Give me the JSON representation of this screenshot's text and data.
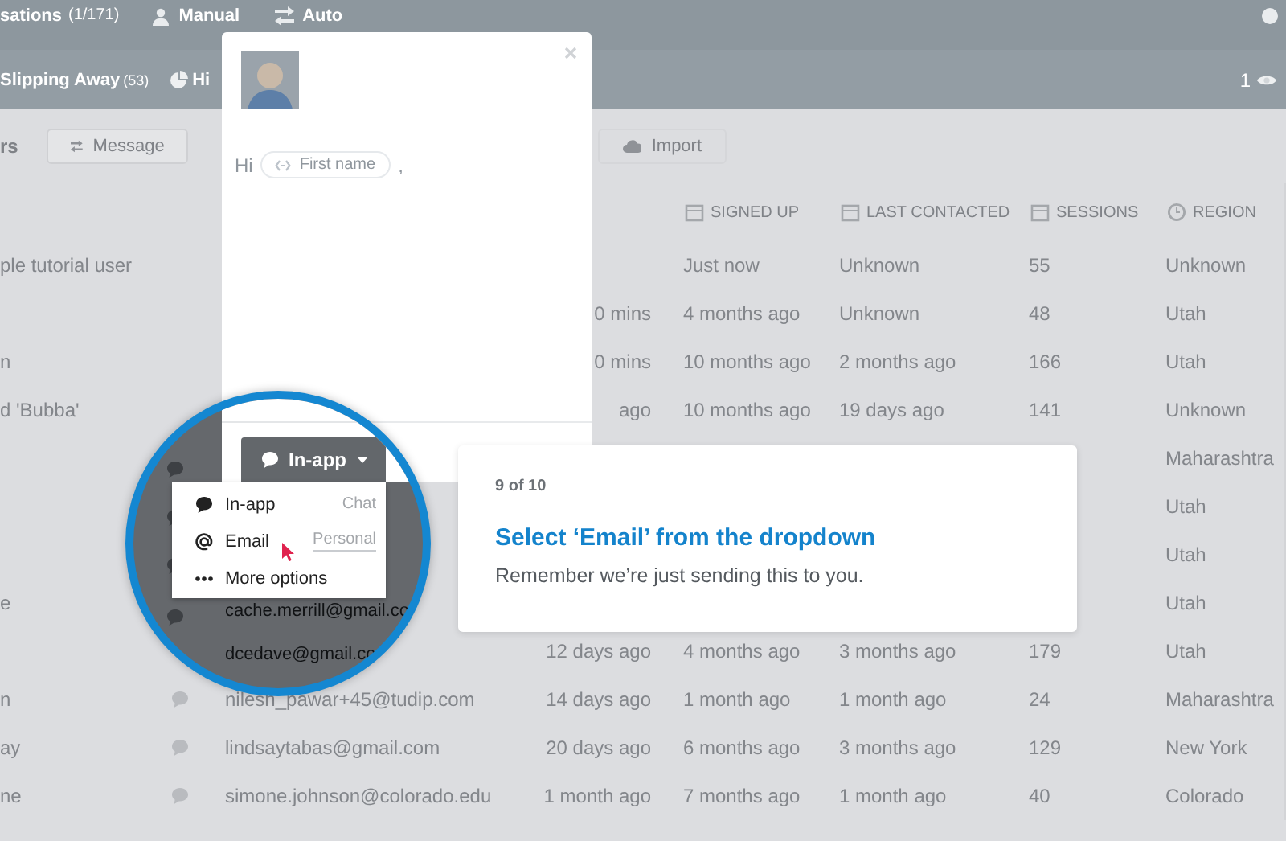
{
  "top_bar": {
    "title": "sations",
    "count": "(1/171)",
    "modes": [
      {
        "kind": "manual",
        "label": "Manual"
      },
      {
        "kind": "auto",
        "label": "Auto"
      }
    ]
  },
  "sub_bar": {
    "title": "Slipping Away",
    "count": "(53)",
    "next_label": "Hi",
    "views": "1"
  },
  "toolbar": {
    "label": "rs",
    "buttons": [
      {
        "kind": "message",
        "label": "Message"
      },
      {
        "kind": "import",
        "label": "Import"
      }
    ]
  },
  "table": {
    "columns": [
      {
        "kind": "signed_up",
        "label": "SIGNED UP"
      },
      {
        "kind": "last_contacted",
        "label": "LAST CONTACTED"
      },
      {
        "kind": "sessions",
        "label": "SESSIONS"
      },
      {
        "kind": "region",
        "label": "REGION"
      }
    ],
    "rows": [
      {
        "name": "ple tutorial user",
        "signed_up": "Just now",
        "last_contacted": "Unknown",
        "sessions": "55",
        "region": "Unknown"
      },
      {
        "column_3": "0 mins",
        "signed_up": "4 months ago",
        "last_contacted": "Unknown",
        "sessions": "48",
        "region": "Utah"
      },
      {
        "name": "n",
        "column_3": "0 mins",
        "signed_up": "10 months ago",
        "last_contacted": "2 months ago",
        "sessions": "166",
        "region": "Utah"
      },
      {
        "name": "d 'Bubba'",
        "column_3": "ago",
        "signed_up": "10 months ago",
        "last_contacted": "19 days ago",
        "sessions": "141",
        "region": "Unknown"
      },
      {
        "region": "Maharashtra"
      },
      {
        "region": "Utah"
      },
      {
        "region": "Utah"
      },
      {
        "name": "e",
        "region": "Utah"
      },
      {
        "column_3": "12 days ago",
        "signed_up": "4 months ago",
        "last_contacted": "3 months ago",
        "sessions": "179",
        "region": "Utah"
      },
      {
        "name": "n",
        "email": "nilesh_pawar+45@tudip.com",
        "column_3": "14 days ago",
        "signed_up": "1 month ago",
        "last_contacted": "1 month ago",
        "sessions": "24",
        "region": "Maharashtra"
      },
      {
        "name": "ay",
        "email": "lindsaytabas@gmail.com",
        "column_3": "20 days ago",
        "signed_up": "6 months ago",
        "last_contacted": "3 months ago",
        "sessions": "129",
        "region": "New York"
      },
      {
        "name": "ne",
        "email": "simone.johnson@colorado.edu",
        "column_3": "1 month ago",
        "signed_up": "7 months ago",
        "last_contacted": "1 month ago",
        "sessions": "40",
        "region": "Colorado"
      }
    ]
  },
  "message_modal": {
    "greeting": "Hi",
    "name_chip": "First name",
    "punctuation": ","
  },
  "magnifier": {
    "channel_button": "In-app",
    "menu": [
      {
        "kind": "chat",
        "label": "In-app",
        "note": "Chat"
      },
      {
        "kind": "email",
        "label": "Email",
        "note": "Personal"
      },
      {
        "kind": "more",
        "label": "More options"
      }
    ],
    "rows": [
      {
        "email": "cache.merrill@gmail.co"
      },
      {
        "email": "dcedave@gmail.co"
      }
    ]
  },
  "tour_card": {
    "step": "9 of 10",
    "title": "Select ‘Email’ from the dropdown",
    "body": "Remember we’re just sending this to you."
  }
}
